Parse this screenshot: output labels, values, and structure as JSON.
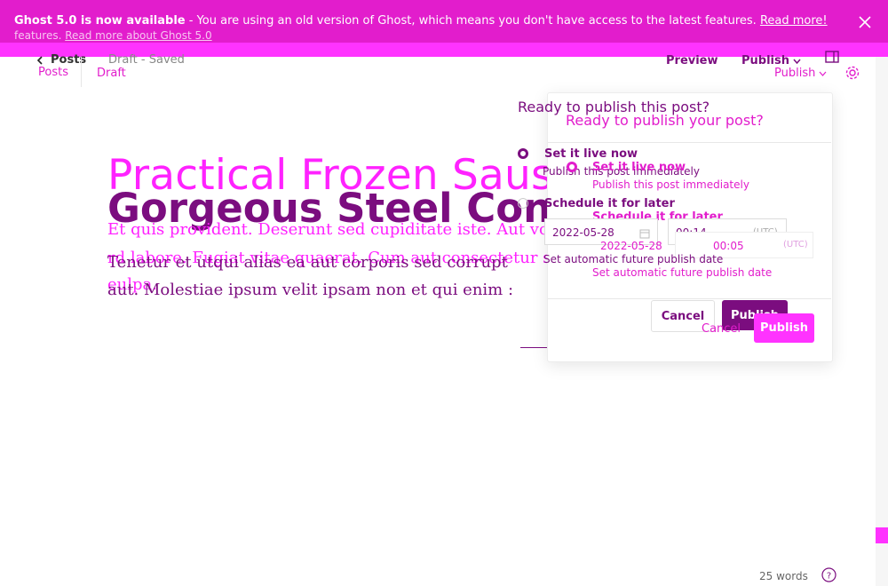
{
  "banner": {
    "text_bold": "Ghost 5.0 is now available",
    "text": " - You are using an old version of Ghost, which means you don't have access to the latest features. ",
    "link": "Read more!",
    "ghost_text": "features.",
    "ghost_link": "Read more about Ghost 5.0",
    "close_icon": "close-icon"
  },
  "header": {
    "back_label": "Posts",
    "back_ghost": "Posts",
    "status": "Draft - Saved",
    "status_ghost": "Draft",
    "preview": "Preview",
    "publish": "Publish",
    "publish_ghost": "Publish"
  },
  "editor": {
    "title": "Practical Frozen Sausag",
    "title_ghost": "Gorgeous Steel Con",
    "line1": "Et quis provident. Deserunt sed cupiditate iste. Aut volu",
    "line2": "rd labore. Fugiat vitae quaerat. Cum aut consectetur sir",
    "line2_ghost": "Tenetur et utqui alias ea aut corporis sed corrupt",
    "line3": "eulpa.",
    "line3_ghost": "aut. Molestiae ipsum velit ipsam non et qui enim :",
    "word_count": "25 words"
  },
  "modal": {
    "title": "Ready to publish your post?",
    "title_ghost": "Ready to publish this post?",
    "now_label": "Set it live now",
    "now_desc": "Publish this post immediately",
    "later_label": "Schedule it for later",
    "later_desc": "Set automatic future publish date",
    "date": "2022-05-28",
    "time": "00:05",
    "time_ghost": "00:14",
    "tz": "(UTC)",
    "cancel": "Cancel",
    "publish": "Publish"
  },
  "colors": {
    "accent": "#ff33ff",
    "accent_dark": "#7b0d7f",
    "banner": "#e21dcc"
  }
}
